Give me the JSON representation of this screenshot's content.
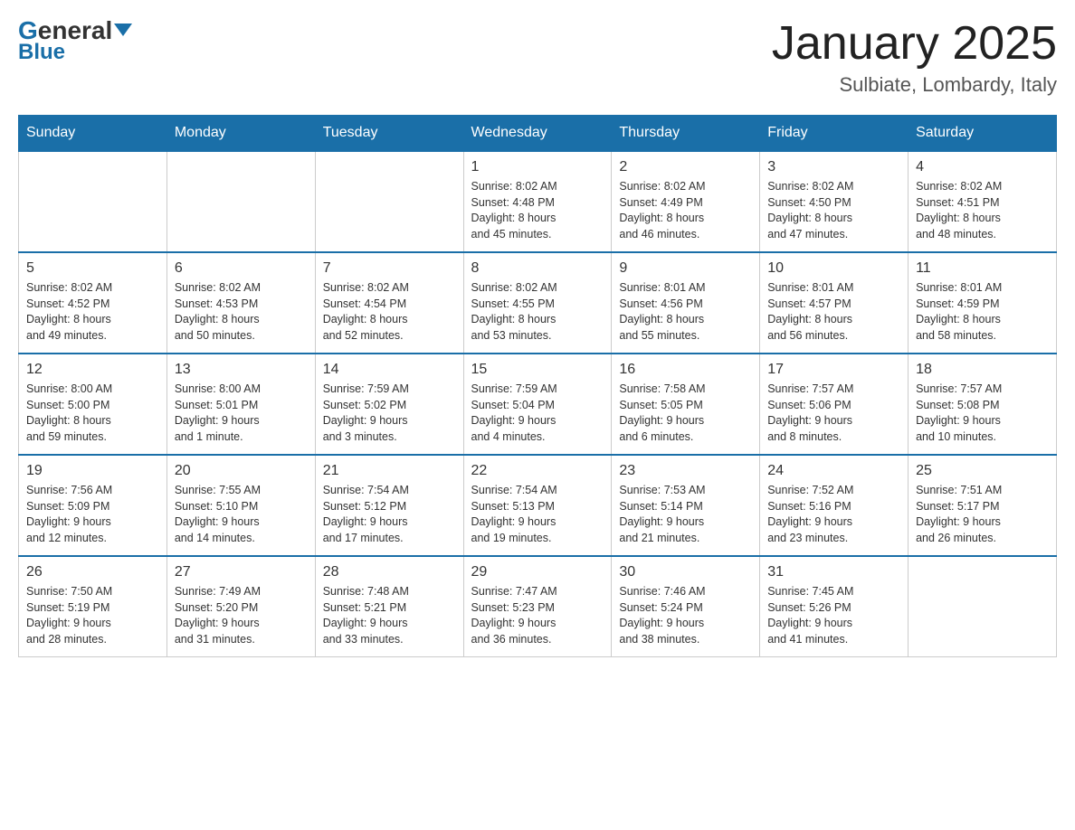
{
  "header": {
    "logo": {
      "general": "General",
      "blue": "Blue",
      "triangle": true
    },
    "title": "January 2025",
    "location": "Sulbiate, Lombardy, Italy"
  },
  "calendar": {
    "days_of_week": [
      "Sunday",
      "Monday",
      "Tuesday",
      "Wednesday",
      "Thursday",
      "Friday",
      "Saturday"
    ],
    "weeks": [
      [
        {
          "day": "",
          "info": ""
        },
        {
          "day": "",
          "info": ""
        },
        {
          "day": "",
          "info": ""
        },
        {
          "day": "1",
          "info": "Sunrise: 8:02 AM\nSunset: 4:48 PM\nDaylight: 8 hours\nand 45 minutes."
        },
        {
          "day": "2",
          "info": "Sunrise: 8:02 AM\nSunset: 4:49 PM\nDaylight: 8 hours\nand 46 minutes."
        },
        {
          "day": "3",
          "info": "Sunrise: 8:02 AM\nSunset: 4:50 PM\nDaylight: 8 hours\nand 47 minutes."
        },
        {
          "day": "4",
          "info": "Sunrise: 8:02 AM\nSunset: 4:51 PM\nDaylight: 8 hours\nand 48 minutes."
        }
      ],
      [
        {
          "day": "5",
          "info": "Sunrise: 8:02 AM\nSunset: 4:52 PM\nDaylight: 8 hours\nand 49 minutes."
        },
        {
          "day": "6",
          "info": "Sunrise: 8:02 AM\nSunset: 4:53 PM\nDaylight: 8 hours\nand 50 minutes."
        },
        {
          "day": "7",
          "info": "Sunrise: 8:02 AM\nSunset: 4:54 PM\nDaylight: 8 hours\nand 52 minutes."
        },
        {
          "day": "8",
          "info": "Sunrise: 8:02 AM\nSunset: 4:55 PM\nDaylight: 8 hours\nand 53 minutes."
        },
        {
          "day": "9",
          "info": "Sunrise: 8:01 AM\nSunset: 4:56 PM\nDaylight: 8 hours\nand 55 minutes."
        },
        {
          "day": "10",
          "info": "Sunrise: 8:01 AM\nSunset: 4:57 PM\nDaylight: 8 hours\nand 56 minutes."
        },
        {
          "day": "11",
          "info": "Sunrise: 8:01 AM\nSunset: 4:59 PM\nDaylight: 8 hours\nand 58 minutes."
        }
      ],
      [
        {
          "day": "12",
          "info": "Sunrise: 8:00 AM\nSunset: 5:00 PM\nDaylight: 8 hours\nand 59 minutes."
        },
        {
          "day": "13",
          "info": "Sunrise: 8:00 AM\nSunset: 5:01 PM\nDaylight: 9 hours\nand 1 minute."
        },
        {
          "day": "14",
          "info": "Sunrise: 7:59 AM\nSunset: 5:02 PM\nDaylight: 9 hours\nand 3 minutes."
        },
        {
          "day": "15",
          "info": "Sunrise: 7:59 AM\nSunset: 5:04 PM\nDaylight: 9 hours\nand 4 minutes."
        },
        {
          "day": "16",
          "info": "Sunrise: 7:58 AM\nSunset: 5:05 PM\nDaylight: 9 hours\nand 6 minutes."
        },
        {
          "day": "17",
          "info": "Sunrise: 7:57 AM\nSunset: 5:06 PM\nDaylight: 9 hours\nand 8 minutes."
        },
        {
          "day": "18",
          "info": "Sunrise: 7:57 AM\nSunset: 5:08 PM\nDaylight: 9 hours\nand 10 minutes."
        }
      ],
      [
        {
          "day": "19",
          "info": "Sunrise: 7:56 AM\nSunset: 5:09 PM\nDaylight: 9 hours\nand 12 minutes."
        },
        {
          "day": "20",
          "info": "Sunrise: 7:55 AM\nSunset: 5:10 PM\nDaylight: 9 hours\nand 14 minutes."
        },
        {
          "day": "21",
          "info": "Sunrise: 7:54 AM\nSunset: 5:12 PM\nDaylight: 9 hours\nand 17 minutes."
        },
        {
          "day": "22",
          "info": "Sunrise: 7:54 AM\nSunset: 5:13 PM\nDaylight: 9 hours\nand 19 minutes."
        },
        {
          "day": "23",
          "info": "Sunrise: 7:53 AM\nSunset: 5:14 PM\nDaylight: 9 hours\nand 21 minutes."
        },
        {
          "day": "24",
          "info": "Sunrise: 7:52 AM\nSunset: 5:16 PM\nDaylight: 9 hours\nand 23 minutes."
        },
        {
          "day": "25",
          "info": "Sunrise: 7:51 AM\nSunset: 5:17 PM\nDaylight: 9 hours\nand 26 minutes."
        }
      ],
      [
        {
          "day": "26",
          "info": "Sunrise: 7:50 AM\nSunset: 5:19 PM\nDaylight: 9 hours\nand 28 minutes."
        },
        {
          "day": "27",
          "info": "Sunrise: 7:49 AM\nSunset: 5:20 PM\nDaylight: 9 hours\nand 31 minutes."
        },
        {
          "day": "28",
          "info": "Sunrise: 7:48 AM\nSunset: 5:21 PM\nDaylight: 9 hours\nand 33 minutes."
        },
        {
          "day": "29",
          "info": "Sunrise: 7:47 AM\nSunset: 5:23 PM\nDaylight: 9 hours\nand 36 minutes."
        },
        {
          "day": "30",
          "info": "Sunrise: 7:46 AM\nSunset: 5:24 PM\nDaylight: 9 hours\nand 38 minutes."
        },
        {
          "day": "31",
          "info": "Sunrise: 7:45 AM\nSunset: 5:26 PM\nDaylight: 9 hours\nand 41 minutes."
        },
        {
          "day": "",
          "info": ""
        }
      ]
    ]
  }
}
